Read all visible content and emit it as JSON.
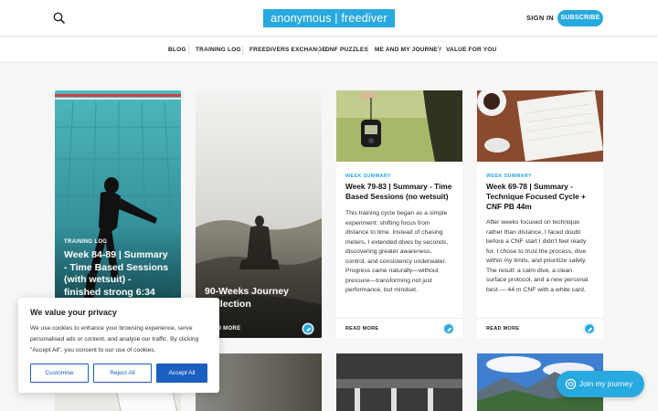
{
  "header": {
    "logo": "anonymous | freediver",
    "sign_in": "SIGN IN",
    "subscribe": "SUBSCRIBE",
    "search_icon": "search-icon"
  },
  "nav": {
    "items": [
      "BLOG",
      "TRAINING LOG",
      "FREEDIVERS EXCHANGE",
      "DNF PUZZLES",
      "ME AND MY JOURNEY",
      "VALUE FOR YOU"
    ]
  },
  "cards": [
    {
      "tag": "TRAINING LOG",
      "title": "Week 84-89 | Summary - Time Based Sessions (with wetsuit) - finished strong 6:34 STA; 129.5m"
    },
    {
      "title": "90-Weeks Journey Collection",
      "read_more": "READ MORE"
    },
    {
      "tag": "WEEK SUMMARY",
      "title": "Week 79-83 | Summary - Time Based Sessions (no wetsuit)",
      "excerpt": "This training cycle began as a simple experiment: shifting focus from distance to time. Instead of chasing meters, I extended dives by seconds, discovering greater awareness, control, and consistency underwater. Progress came naturally—without pressure—transforming not just performance, but mindset.",
      "read_more": "READ MORE"
    },
    {
      "tag": "WEEK SUMMARY",
      "title": "Week 69-78 | Summary - Technique Focused Cycle + CNF PB 44m",
      "excerpt": "After weeks focused on technique rather than distance, I faced doubt before a CNF start I didn't feel ready for. I chose to trust the process, dive within my limits, and prioritize safety. The result: a calm dive, a clean surface protocol, and a new personal best — 44 m CNF with a white card.",
      "read_more": "READ MORE"
    }
  ],
  "cookie": {
    "title": "We value your privacy",
    "text": "We use cookies to enhance your browsing experience, serve personalised ads or content, and analyse our traffic. By clicking \"Accept All\", you consent to our use of cookies.",
    "customise": "Customise",
    "reject": "Reject All",
    "accept": "Accept All"
  },
  "join": {
    "label": "Join my journey"
  },
  "colors": {
    "accent": "#28a9e0",
    "cookie_blue": "#1b5fc0"
  }
}
